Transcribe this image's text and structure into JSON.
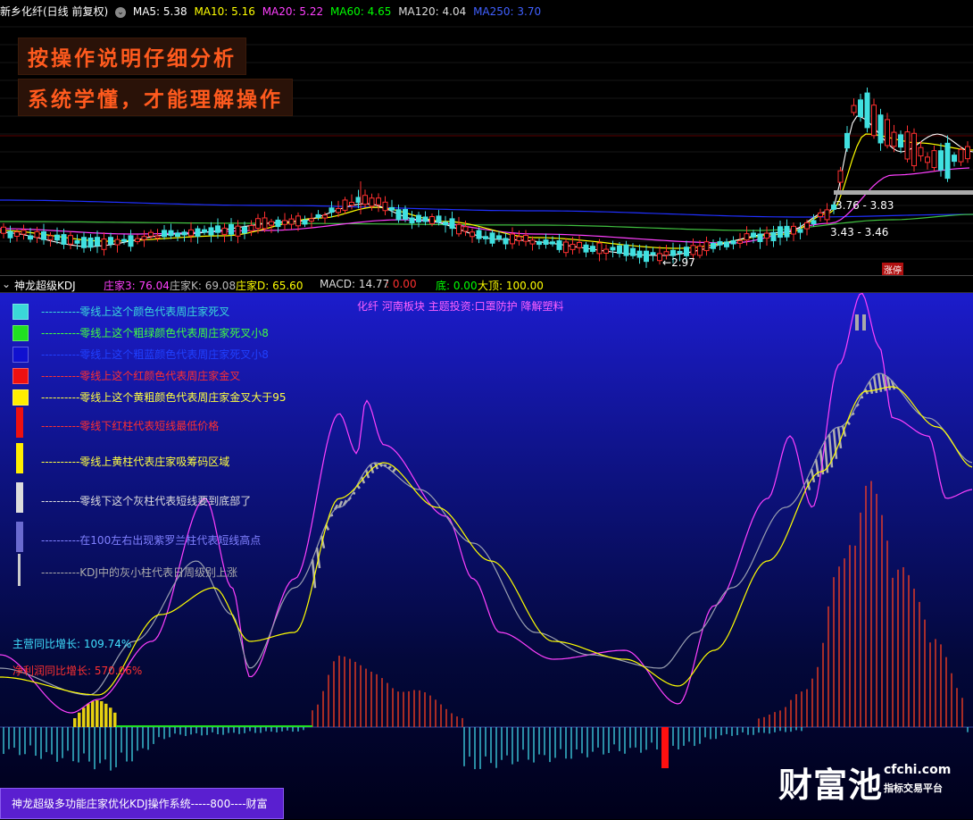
{
  "top_panel": {
    "title": "新乡化纤(日线 前复权)",
    "ma_items": [
      {
        "label": "MA5: 5.38",
        "color": "#ffffff"
      },
      {
        "label": "MA10: 5.16",
        "color": "#ffff00"
      },
      {
        "label": "MA20: 5.22",
        "color": "#ff40ff"
      },
      {
        "label": "MA60: 4.65",
        "color": "#00ff00"
      },
      {
        "label": "MA120: 4.04",
        "color": "#dddddd"
      },
      {
        "label": "MA250: 3.70",
        "color": "#4060ff"
      }
    ],
    "headline_1": "按操作说明仔细分析",
    "headline_2": "系统学懂，才能理解操作",
    "price_label_range_1": "3.76 - 3.83",
    "price_label_range_2": "3.43 - 3.46",
    "low_label": "2.97",
    "badge": "涨停"
  },
  "indicator_bar": {
    "name": "神龙超级KDJ",
    "items": [
      {
        "label": "庄家3: 76.04",
        "color": "#ff40ff"
      },
      {
        "label": "庄家K: 69.08",
        "color": "#bbbbbb"
      },
      {
        "label": "庄家D: 65.60",
        "color": "#ffff00"
      },
      {
        "label": "MACD: 14.77",
        "color": "#dddddd"
      },
      {
        "label": ": 0.00",
        "color": "#ff3030"
      },
      {
        "label": "底: 0.00",
        "color": "#00ff00"
      },
      {
        "label": "大顶: 100.00",
        "color": "#ffff00"
      }
    ]
  },
  "bottom_panel": {
    "sector_info": "化纤 河南板块 主题投资:口罩防护 降解塑料",
    "legend": [
      {
        "text": "----------零线上这个颜色代表周庄家死叉",
        "color": "#3ad8d8",
        "swatch": "#3ad8d8",
        "shape": "square"
      },
      {
        "text": "----------零线上这个粗绿颜色代表周庄家死叉小8",
        "color": "#40ff40",
        "swatch": "#20e020",
        "shape": "square"
      },
      {
        "text": "----------零线上这个粗蓝颜色代表周庄家死叉小8",
        "color": "#2040ff",
        "swatch": "#1010d0",
        "shape": "square"
      },
      {
        "text": "----------零线上这个红颜色代表周庄家金叉",
        "color": "#ff3030",
        "swatch": "#ee1010",
        "shape": "square"
      },
      {
        "text": "----------零线上这个黄粗颜色代表周庄家金叉大于95",
        "color": "#ffff40",
        "swatch": "#ffee00",
        "shape": "square"
      },
      {
        "text": "----------零线下红柱代表短线最低价格",
        "color": "#ff3030",
        "swatch": "#ee1010",
        "shape": "bar"
      },
      {
        "text": "----------零线上黄柱代表庄家吸筹码区域",
        "color": "#ffff40",
        "swatch": "#ffee00",
        "shape": "bar"
      },
      {
        "text": "----------零线下这个灰柱代表短线要到底部了",
        "color": "#dddddd",
        "swatch": "#dddddd",
        "shape": "bar"
      },
      {
        "text": "----------在100左右出现紫罗兰柱代表短线高点",
        "color": "#8080ff",
        "swatch": "#6a6ad0",
        "shape": "bar"
      },
      {
        "text": "----------KDJ中的灰小柱代表日周级别上涨",
        "color": "#aaaaaa",
        "swatch": "#cccccc",
        "shape": "thin"
      }
    ],
    "revenue_growth": "主营同比增长: 109.74%",
    "profit_growth": "净利润同比增长: 570.06%"
  },
  "footer": {
    "text": "神龙超级多功能庄家优化KDJ操作系统-----800----财富"
  },
  "watermark": {
    "brand": "财富池",
    "domain": "cfchi.com",
    "tagline": "指标交易平台"
  }
}
